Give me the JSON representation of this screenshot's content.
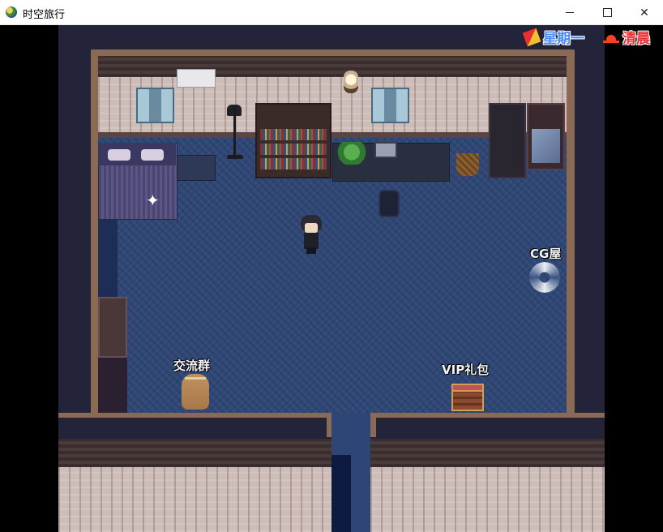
{
  "window": {
    "title": "时空旅行",
    "minimize_icon": "minimize-icon",
    "maximize_icon": "maximize-icon",
    "close_icon": "close-icon",
    "close_glyph": "✕"
  },
  "hud": {
    "day_label": "星期一",
    "day_icon": "calendar-icon",
    "time_label": "清晨",
    "time_icon": "sunrise-icon"
  },
  "map": {
    "labels": {
      "cg_room": "CG屋",
      "group_chat": "交流群",
      "vip_gift": "VIP礼包"
    },
    "sparkle_glyph": "✦"
  }
}
